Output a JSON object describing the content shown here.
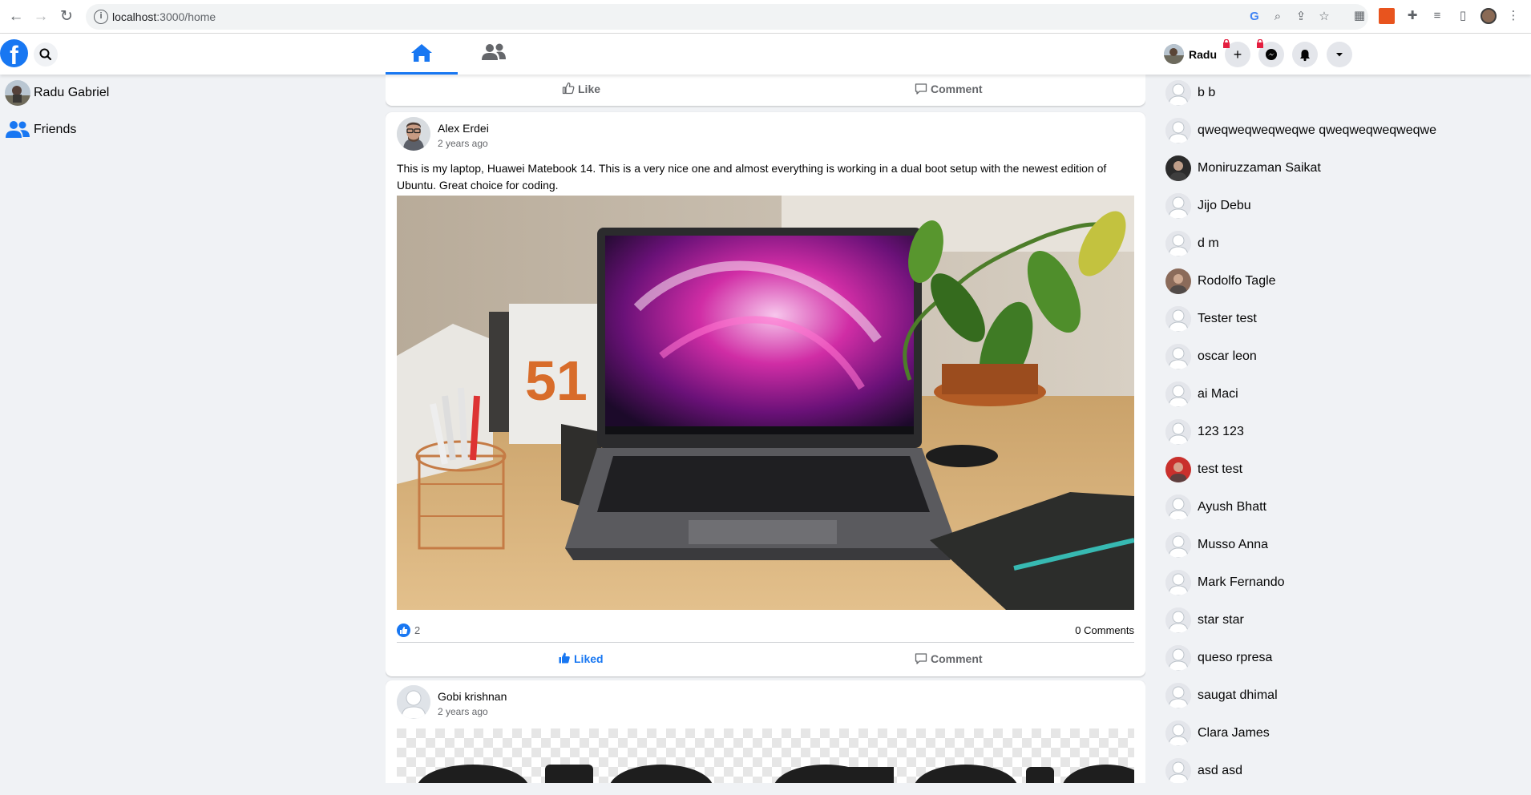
{
  "browser": {
    "url_host": "localhost",
    "url_rest": ":3000/home"
  },
  "header": {
    "logo": "f",
    "user_name": "Radu"
  },
  "left_nav": {
    "items": [
      {
        "label": "Radu Gabriel",
        "icon": "avatar"
      },
      {
        "label": "Friends",
        "icon": "friends-icon"
      }
    ]
  },
  "feed": {
    "top_card": {
      "like_label": "Like",
      "comment_label": "Comment"
    },
    "posts": [
      {
        "author": "Alex Erdei",
        "time": "2 years ago",
        "text": "This is my laptop, Huawei Matebook 14. This is a very nice one and almost everything is working in a dual boot setup with the newest edition of Ubuntu. Great choice for coding.",
        "likes": "2",
        "comments": "0 Comments",
        "like_label": "Liked",
        "comment_label": "Comment"
      },
      {
        "author": "Gobi krishnan",
        "time": "2 years ago"
      }
    ]
  },
  "contacts": [
    {
      "name": "b b",
      "avatar": "default"
    },
    {
      "name": "qweqweqweqweqwe qweqweqweqweqwe",
      "avatar": "default"
    },
    {
      "name": "Moniruzzaman Saikat",
      "avatar": "photo"
    },
    {
      "name": "Jijo Debu",
      "avatar": "default"
    },
    {
      "name": "d m",
      "avatar": "default"
    },
    {
      "name": "Rodolfo Tagle",
      "avatar": "photo"
    },
    {
      "name": "Tester test",
      "avatar": "default"
    },
    {
      "name": "oscar leon",
      "avatar": "default"
    },
    {
      "name": "ai Maci",
      "avatar": "default"
    },
    {
      "name": "123 123",
      "avatar": "default"
    },
    {
      "name": "test test",
      "avatar": "photo"
    },
    {
      "name": "Ayush Bhatt",
      "avatar": "default"
    },
    {
      "name": "Musso Anna",
      "avatar": "default"
    },
    {
      "name": "Mark Fernando",
      "avatar": "default"
    },
    {
      "name": "star star",
      "avatar": "default"
    },
    {
      "name": "queso rpresa",
      "avatar": "default"
    },
    {
      "name": "saugat dhimal",
      "avatar": "default"
    },
    {
      "name": "Clara James",
      "avatar": "default"
    },
    {
      "name": "asd asd",
      "avatar": "default"
    }
  ],
  "colors": {
    "brand": "#1877f2",
    "background": "#f0f2f5",
    "text_secondary": "#65676b"
  }
}
